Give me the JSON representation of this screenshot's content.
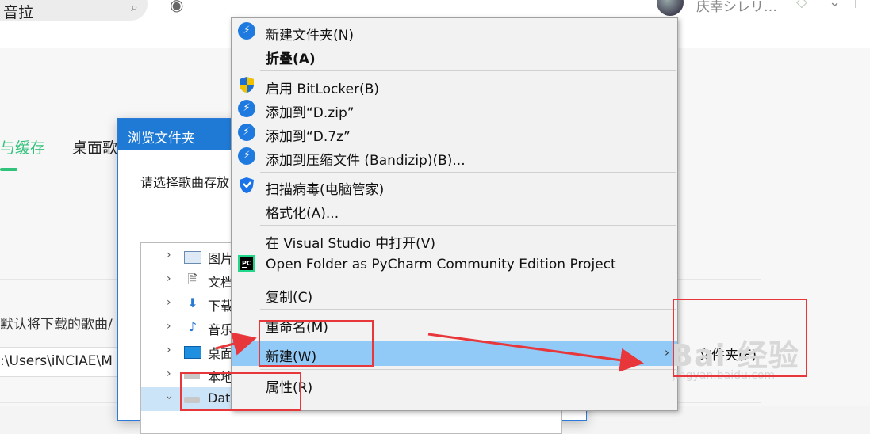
{
  "app": {
    "search": {
      "text": "音拉"
    },
    "username": "庆幸シレリ…",
    "tabs": [
      {
        "label": "与缓存"
      },
      {
        "label": "桌面歌"
      }
    ],
    "hint": "默认将下载的歌曲/",
    "path": ":\\Users\\iNCIAE\\M"
  },
  "dialog": {
    "title": "浏览文件夹",
    "prompt": "请选择歌曲存放",
    "tree": [
      {
        "label": "图片",
        "icon": "pictures-icon"
      },
      {
        "label": "文档",
        "icon": "documents-icon"
      },
      {
        "label": "下载",
        "icon": "download-icon"
      },
      {
        "label": "音乐",
        "icon": "music-icon"
      },
      {
        "label": "桌面",
        "icon": "desktop-icon"
      },
      {
        "label": "本地",
        "icon": "drive-icon"
      },
      {
        "label": "Data (D:)",
        "icon": "drive-icon",
        "selected": true
      }
    ]
  },
  "context_menu": {
    "items": [
      {
        "label": "新建文件夹(N)",
        "icon": "bandizip-icon"
      },
      {
        "label": "折叠(A)",
        "bold": true
      },
      {
        "label": "启用 BitLocker(B)",
        "icon": "shield-icon"
      },
      {
        "label": "添加到“D.zip”",
        "icon": "bandizip-icon"
      },
      {
        "label": "添加到“D.7z”",
        "icon": "bandizip-icon"
      },
      {
        "label": "添加到压缩文件 (Bandizip)(B)...",
        "icon": "bandizip-icon"
      },
      {
        "label": "扫描病毒(电脑管家)",
        "icon": "tencent-guard-icon"
      },
      {
        "label": "格式化(A)..."
      },
      {
        "label": "在 Visual Studio 中打开(V)"
      },
      {
        "label": "Open Folder as PyCharm Community Edition Project",
        "icon": "pycharm-icon"
      },
      {
        "label": "复制(C)"
      },
      {
        "label": "重命名(M)"
      },
      {
        "label": "新建(W)",
        "hover": true,
        "submenu": true
      },
      {
        "label": "属性(R)"
      }
    ]
  },
  "submenu": {
    "item": "文件夹(F)"
  },
  "watermark": {
    "text": "Bai 经验",
    "url": "jingyan.baidu.com"
  },
  "colors": {
    "accent": "#31c27c",
    "highlight": "#91c9f7",
    "annotation": "#e8373b",
    "title_bar": "#1e7ad5"
  }
}
